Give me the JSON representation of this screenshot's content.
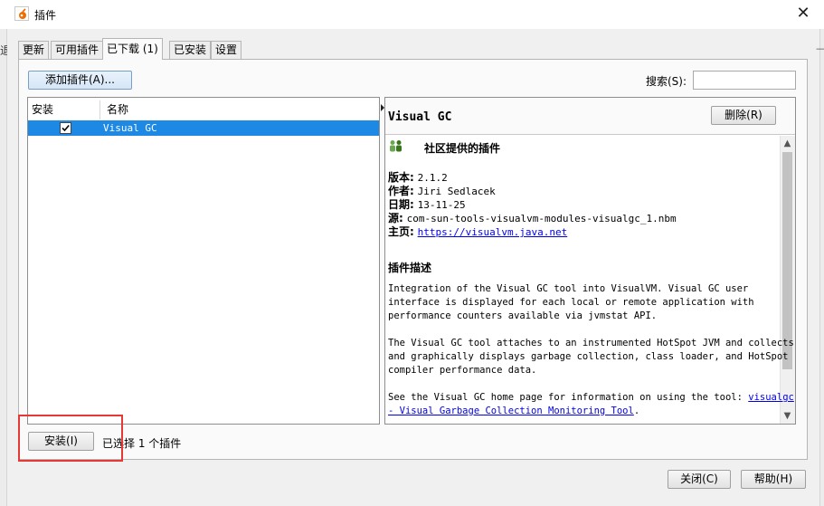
{
  "window": {
    "title": "插件",
    "close_glyph": "✕",
    "bg_left_glyph": "退",
    "bg_right_glyph": "—"
  },
  "tabs": [
    {
      "label": "更新",
      "active": false
    },
    {
      "label": "可用插件",
      "active": false
    },
    {
      "label": "已下载 (1)",
      "active": true
    },
    {
      "label": "已安装",
      "active": false
    },
    {
      "label": "设置",
      "active": false
    }
  ],
  "toolbar": {
    "add_plugin_label": "添加插件(A)...",
    "search_label": "搜索(S):",
    "search_value": ""
  },
  "table": {
    "columns": [
      "安装",
      "名称"
    ],
    "rows": [
      {
        "install": true,
        "name": "Visual GC"
      }
    ]
  },
  "details": {
    "title": "Visual GC",
    "delete_label": "删除(R)",
    "community_label": "社区提供的插件",
    "version_label": "版本:",
    "version": "2.1.2",
    "author_label": "作者:",
    "author": "Jiri Sedlacek",
    "date_label": "日期:",
    "date": "13-11-25",
    "source_label": "源:",
    "source": "com-sun-tools-visualvm-modules-visualgc_1.nbm",
    "home_label": "主页:",
    "home_url": "https://visualvm.java.net",
    "description_title": "插件描述",
    "para1": "Integration of the Visual GC tool into VisualVM. Visual GC user\ninterface is displayed for each local or remote application with\nperformance counters available via jvmstat API.",
    "para2": "The Visual GC tool attaches to an instrumented HotSpot JVM and collects\nand graphically displays garbage collection, class loader, and HotSpot\ncompiler performance data.",
    "para3_text": "See the Visual GC home page for information on using the tool: ",
    "para3_link_a": "visualgc",
    "para3_link_b": "- Visual Garbage Collection Monitoring Tool",
    "para3_end": ".",
    "scroll_up_glyph": "▲",
    "scroll_down_glyph": "▼"
  },
  "footer": {
    "install_label": "安装(I)",
    "selected_status": "已选择 1 个插件",
    "close_label": "关闭(C)",
    "help_label": "帮助(H)"
  },
  "colors": {
    "selection": "#1e88e5",
    "highlight": "#e53935",
    "link": "#0000ee"
  },
  "icons": {
    "app": "visualvm-app-icon",
    "community": "community-people-icon",
    "check": "checkmark-icon"
  }
}
